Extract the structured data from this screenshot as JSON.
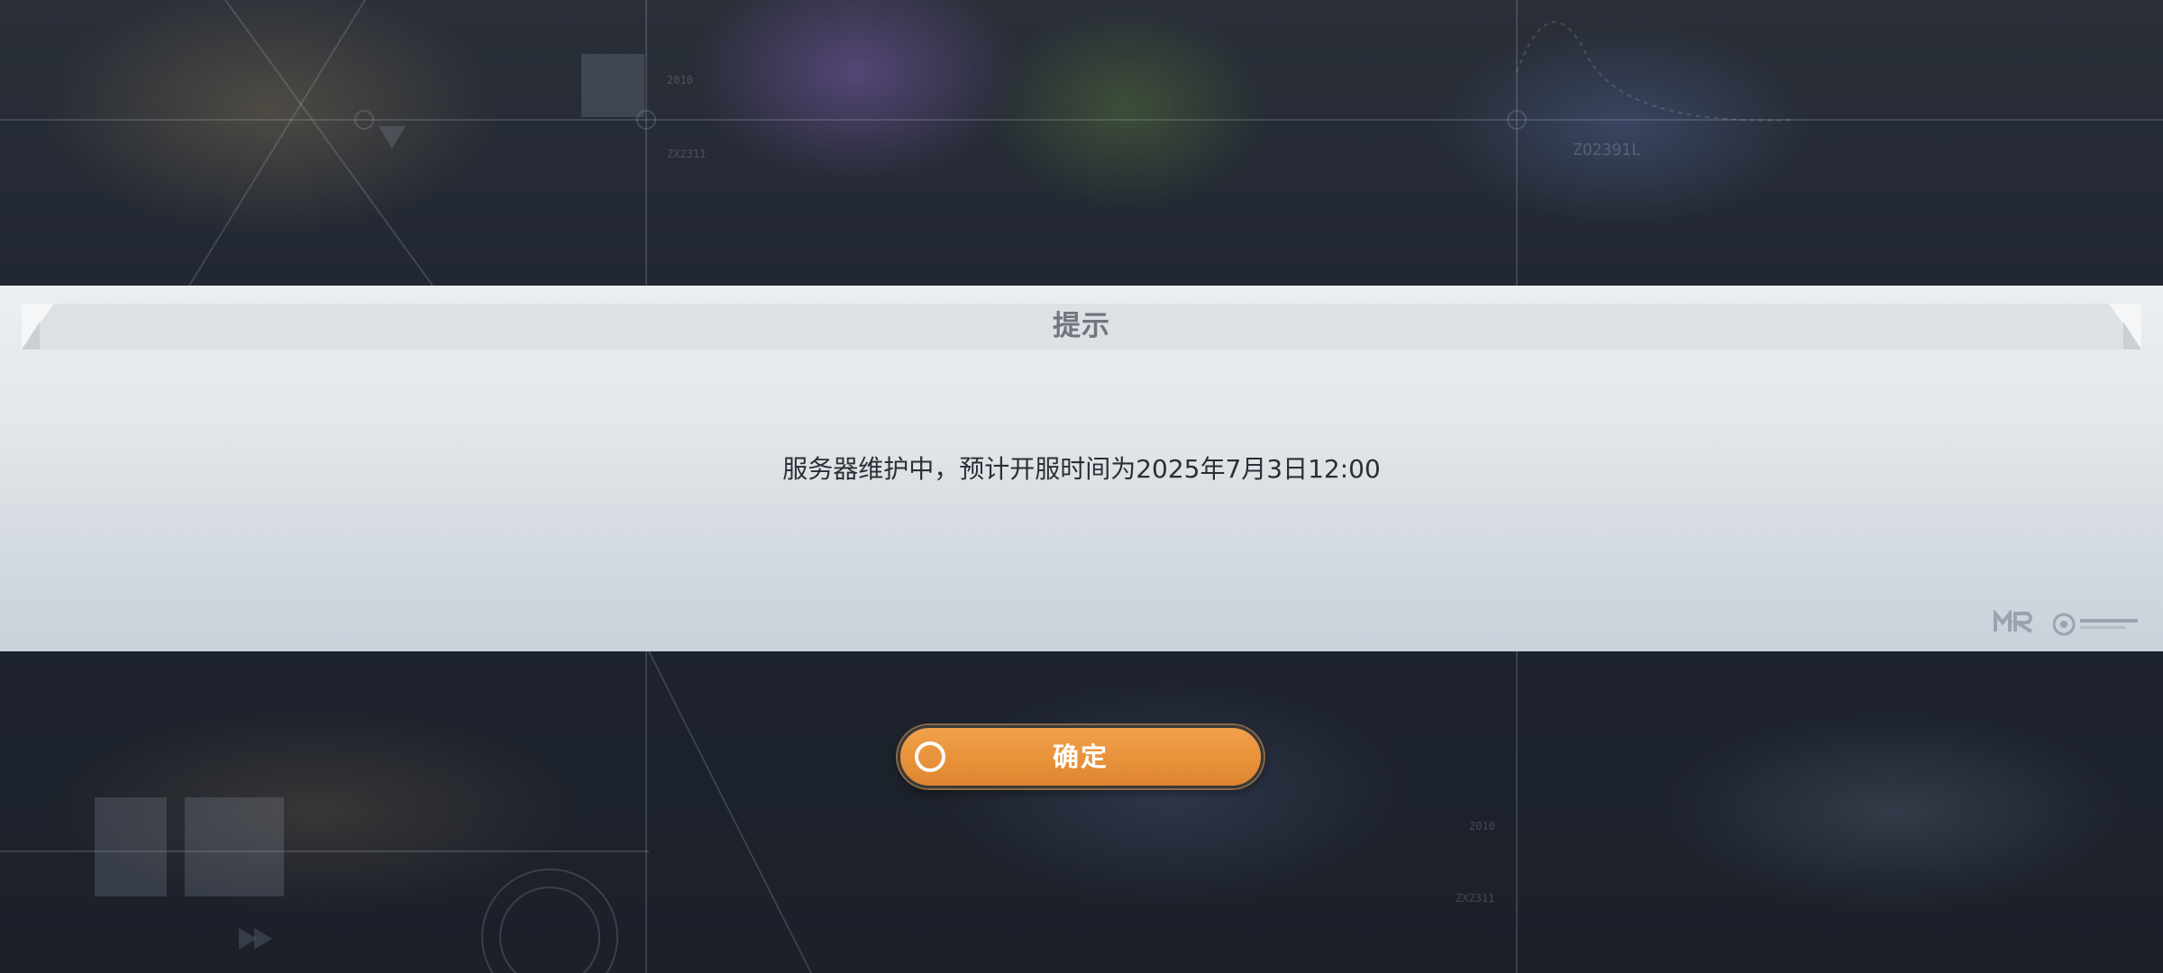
{
  "dialog": {
    "title": "提示",
    "message": "服务器维护中，预计开服时间为2025年7月3日12:00"
  },
  "confirm": {
    "label": "确定"
  },
  "colors": {
    "accent_orange": "#e8923a",
    "dialog_bg": "#e3e7ea",
    "title_text": "#6f7680",
    "message_text": "#2a2f36"
  },
  "icons": {
    "confirm": "circle-icon",
    "brand_mr": "mr-logo",
    "brand_studio": "studio-logo"
  }
}
